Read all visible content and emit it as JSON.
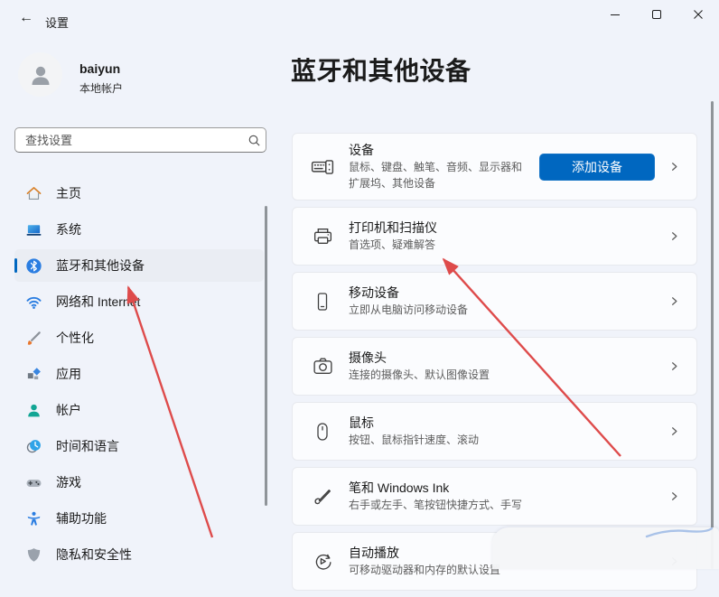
{
  "window": {
    "title": "设置",
    "back_label": "←"
  },
  "user": {
    "name": "baiyun",
    "account_type": "本地帐户"
  },
  "search": {
    "placeholder": "查找设置"
  },
  "sidebar": {
    "items": [
      {
        "label": "主页",
        "icon": "home-icon",
        "selected": false
      },
      {
        "label": "系统",
        "icon": "system-icon",
        "selected": false
      },
      {
        "label": "蓝牙和其他设备",
        "icon": "bluetooth-icon",
        "selected": true
      },
      {
        "label": "网络和 Internet",
        "icon": "network-icon",
        "selected": false
      },
      {
        "label": "个性化",
        "icon": "personalization-icon",
        "selected": false
      },
      {
        "label": "应用",
        "icon": "apps-icon",
        "selected": false
      },
      {
        "label": "帐户",
        "icon": "accounts-icon",
        "selected": false
      },
      {
        "label": "时间和语言",
        "icon": "time-language-icon",
        "selected": false
      },
      {
        "label": "游戏",
        "icon": "gaming-icon",
        "selected": false
      },
      {
        "label": "辅助功能",
        "icon": "accessibility-icon",
        "selected": false
      },
      {
        "label": "隐私和安全性",
        "icon": "privacy-icon",
        "selected": false
      }
    ]
  },
  "page": {
    "title": "蓝牙和其他设备"
  },
  "cards": [
    {
      "icon": "devices-icon",
      "title": "设备",
      "subtitle": "鼠标、键盘、触笔、音频、显示器和扩展坞、其他设备",
      "button": "添加设备"
    },
    {
      "icon": "printer-icon",
      "title": "打印机和扫描仪",
      "subtitle": "首选项、疑难解答"
    },
    {
      "icon": "mobile-devices-icon",
      "title": "移动设备",
      "subtitle": "立即从电脑访问移动设备"
    },
    {
      "icon": "camera-icon",
      "title": "摄像头",
      "subtitle": "连接的摄像头、默认图像设置"
    },
    {
      "icon": "mouse-icon",
      "title": "鼠标",
      "subtitle": "按钮、鼠标指针速度、滚动"
    },
    {
      "icon": "pen-icon",
      "title": "笔和 Windows Ink",
      "subtitle": "右手或左手、笔按钮快捷方式、手写"
    },
    {
      "icon": "autoplay-icon",
      "title": "自动播放",
      "subtitle": "可移动驱动器和内存的默认设置"
    }
  ],
  "colors": {
    "accent": "#0067c0",
    "annotation_red": "#de4b4b",
    "background": "#f0f3fa",
    "card_background": "#fbfcfe"
  },
  "annotations": {
    "arrows": [
      {
        "points_to": "蓝牙和其他设备 (sidebar item)"
      },
      {
        "points_to": "打印机和扫描仪 (card)"
      }
    ]
  }
}
